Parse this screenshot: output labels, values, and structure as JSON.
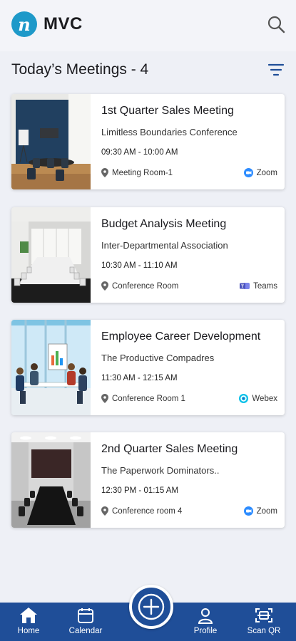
{
  "app": {
    "name": "MVC",
    "logo_letter": "n"
  },
  "heading": "Today’s Meetings - 4",
  "meetings": [
    {
      "title": "1st Quarter Sales Meeting",
      "organization": "Limitless Boundaries Conference",
      "time": "09:30 AM - 10:00 AM",
      "location": "Meeting Room-1",
      "platform": "Zoom"
    },
    {
      "title": "Budget Analysis Meeting",
      "organization": "Inter-Departmental Association",
      "time": "10:30 AM - 11:10 AM",
      "location": "Conference Room",
      "platform": "Teams"
    },
    {
      "title": "Employee Career Development",
      "organization": "The Productive Compadres",
      "time": "11:30 AM - 12:15 AM",
      "location": "Conference Room 1",
      "platform": "Webex"
    },
    {
      "title": "2nd Quarter Sales Meeting",
      "organization": "The Paperwork Dominators..",
      "time": "12:30 PM - 01:15 AM",
      "location": "Conference room 4",
      "platform": "Zoom"
    }
  ],
  "nav": {
    "home": "Home",
    "calendar": "Calendar",
    "profile": "Profile",
    "scan": "Scan QR"
  },
  "colors": {
    "brand": "#1f4e98",
    "logo": "#1e99c9",
    "zoom": "#2d8cff",
    "teams": "#4b53bc",
    "webex": "#07c0e8"
  },
  "icons": [
    "search-icon",
    "filter-icon",
    "location-pin-icon",
    "zoom-icon",
    "teams-icon",
    "webex-icon",
    "home-icon",
    "calendar-icon",
    "plus-icon",
    "profile-icon",
    "scan-qr-icon"
  ]
}
